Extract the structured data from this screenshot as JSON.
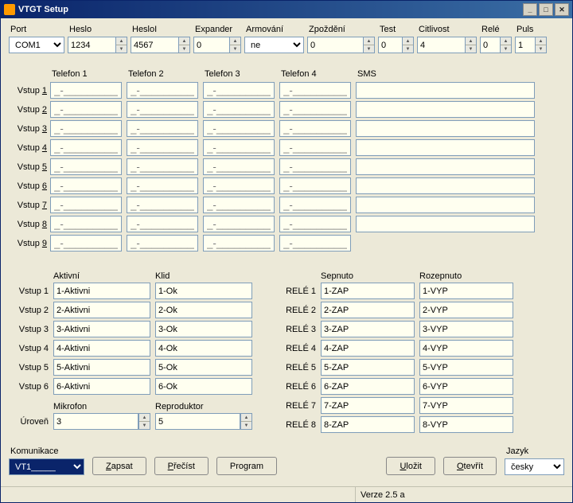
{
  "title": "VTGT Setup",
  "row1": {
    "port": {
      "label": "Port",
      "value": "COM1"
    },
    "heslo": {
      "label": "Heslo",
      "value": "1234"
    },
    "heslol": {
      "label": "HesloI",
      "value": "4567"
    },
    "expander": {
      "label": "Expander",
      "value": "0"
    },
    "armovani": {
      "label": "Armování",
      "value": "ne"
    },
    "zpozdeni": {
      "label": "Zpoždění",
      "value": "0"
    },
    "test": {
      "label": "Test",
      "value": "0"
    },
    "citlivost": {
      "label": "Citlivost",
      "value": "4"
    },
    "rele": {
      "label": "Relé",
      "value": "0"
    },
    "puls": {
      "label": "Puls",
      "value": "1"
    }
  },
  "gridheads": {
    "t1": "Telefon 1",
    "t2": "Telefon 2",
    "t3": "Telefon 3",
    "t4": "Telefon 4",
    "sms": "SMS"
  },
  "vstuplabels": [
    "Vstup 1",
    "Vstup 2",
    "Vstup 3",
    "Vstup 4",
    "Vstup 5",
    "Vstup 6",
    "Vstup 7",
    "Vstup 8",
    "Vstup 9"
  ],
  "cellph": "_-_______________",
  "lower_left": {
    "aktivni_h": "Aktivní",
    "klid_h": "Klid",
    "rows": [
      {
        "lab": "Vstup 1",
        "a": "1-Aktivni",
        "k": "1-Ok"
      },
      {
        "lab": "Vstup 2",
        "a": "2-Aktivni",
        "k": "2-Ok"
      },
      {
        "lab": "Vstup 3",
        "a": "3-Aktivni",
        "k": "3-Ok"
      },
      {
        "lab": "Vstup 4",
        "a": "4-Aktivni",
        "k": "4-Ok"
      },
      {
        "lab": "Vstup 5",
        "a": "5-Aktivni",
        "k": "5-Ok"
      },
      {
        "lab": "Vstup 6",
        "a": "6-Aktivni",
        "k": "6-Ok"
      }
    ],
    "mikrofon_h": "Mikrofon",
    "repro_h": "Reproduktor",
    "uroven": "Úroveň",
    "mik": "3",
    "rep": "5"
  },
  "lower_right": {
    "sep_h": "Sepnuto",
    "roz_h": "Rozepnuto",
    "rows": [
      {
        "lab": "RELÉ 1",
        "s": "1-ZAP",
        "r": "1-VYP"
      },
      {
        "lab": "RELÉ 2",
        "s": "2-ZAP",
        "r": "2-VYP"
      },
      {
        "lab": "RELÉ 3",
        "s": "3-ZAP",
        "r": "3-VYP"
      },
      {
        "lab": "RELÉ 4",
        "s": "4-ZAP",
        "r": "4-VYP"
      },
      {
        "lab": "RELÉ 5",
        "s": "5-ZAP",
        "r": "5-VYP"
      },
      {
        "lab": "RELÉ 6",
        "s": "6-ZAP",
        "r": "6-VYP"
      },
      {
        "lab": "RELÉ 7",
        "s": "7-ZAP",
        "r": "7-VYP"
      },
      {
        "lab": "RELÉ 8",
        "s": "8-ZAP",
        "r": "8-VYP"
      }
    ]
  },
  "bottom": {
    "kom_l": "Komunikace",
    "kom_v": "VT1_____",
    "zapsat": "Zapsat",
    "precist": "Přečíst",
    "program": "Program",
    "ulozit": "Uložit",
    "otevrit": "Otevřít",
    "jazyk_l": "Jazyk",
    "jazyk_v": "česky"
  },
  "status": "Verze 2.5 a"
}
